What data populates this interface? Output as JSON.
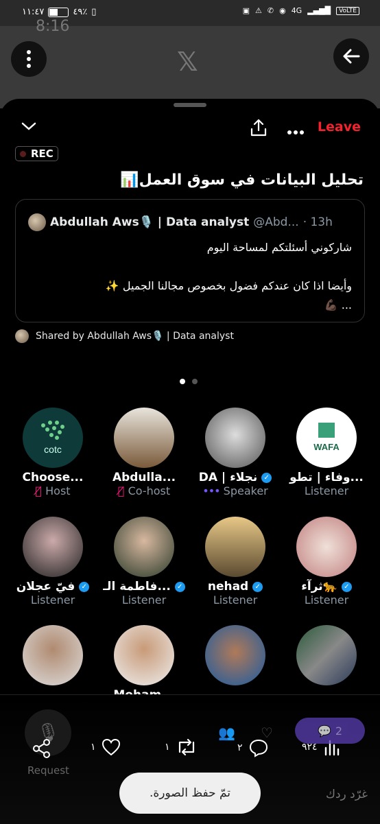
{
  "status_bar": {
    "time": "١١:٤٧",
    "battery": "٤٩٪",
    "network": "4G",
    "volte": "VoLTE"
  },
  "bg_page": {
    "time_ghost": "8:16"
  },
  "header": {
    "leave_label": "Leave",
    "rec_label": "REC"
  },
  "space": {
    "title": "تحليل البيانات في سوق العمل📊"
  },
  "pinned_post": {
    "author": "Abdullah Aws🎙️ | Data analyst",
    "handle": "@Abd...",
    "time": "· 13h",
    "line1": "شاركوني أسئلتكم لمساحة اليوم",
    "line2": "وأيضا اذا كان عندكم فضول بخصوص مجالنا الجميل ✨",
    "line3": "... 💪🏿"
  },
  "shared_by": "Shared by Abdullah Aws🎙️ | Data analyst",
  "participants": [
    {
      "name": "Choose...",
      "role": "Host"
    },
    {
      "name": "Abdulla...",
      "role": "Co-host"
    },
    {
      "name": "DA | نجلاء",
      "role": "Speaker"
    },
    {
      "name": "وفاء | تطو...",
      "role": "Listener"
    },
    {
      "name": "فيّ عجلان",
      "role": "Listener"
    },
    {
      "name": "فاطمة الـ...",
      "role": "Listener"
    },
    {
      "name": "nehad",
      "role": "Listener"
    },
    {
      "name": "ثرآء🐆",
      "role": "Listener"
    },
    {
      "name": "",
      "role": ""
    },
    {
      "name": "Moham...",
      "role": ""
    },
    {
      "name": "",
      "role": ""
    },
    {
      "name": "",
      "role": ""
    }
  ],
  "avatar_labels": {
    "host_logo": "cotc",
    "wafa_logo": "WAFA"
  },
  "bottom": {
    "request_label": "Request",
    "views": "٩٢٤",
    "replies": "٢",
    "reposts": "١",
    "likes": "١",
    "comments_badge": "2",
    "reply_placeholder": "غرّد ردك",
    "toast": "تمّ حفظ الصورة."
  }
}
